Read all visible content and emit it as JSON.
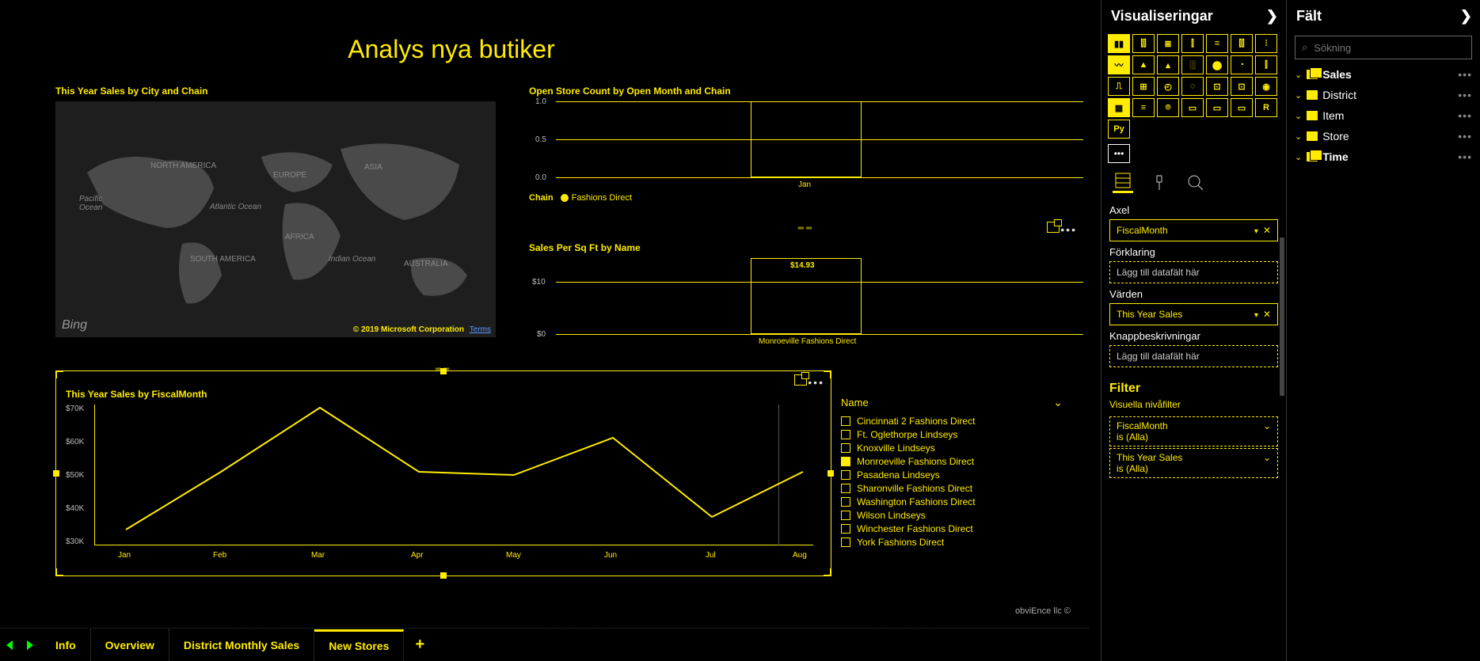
{
  "page_title": "Analys nya butiker",
  "map": {
    "title": "This Year Sales by City and Chain",
    "labels": [
      "NORTH AMERICA",
      "EUROPE",
      "ASIA",
      "AFRICA",
      "SOUTH AMERICA",
      "AUSTRALIA",
      "Pacific Ocean",
      "Atlantic Ocean",
      "Indian Ocean"
    ],
    "provider": "Bing",
    "copyright": "© 2019 Microsoft Corporation",
    "terms": "Terms"
  },
  "bar1": {
    "title": "Open Store Count by Open Month and Chain",
    "legend_label": "Chain",
    "legend_item": "Fashions Direct"
  },
  "bar2": {
    "title": "Sales Per Sq Ft by Name",
    "value_label": "$14.93"
  },
  "line": {
    "title": "This Year Sales by FiscalMonth"
  },
  "slicer": {
    "title": "Name",
    "items": [
      {
        "label": "Cincinnati 2 Fashions Direct",
        "checked": false
      },
      {
        "label": "Ft. Oglethorpe Lindseys",
        "checked": false
      },
      {
        "label": "Knoxville Lindseys",
        "checked": false
      },
      {
        "label": "Monroeville Fashions Direct",
        "checked": true
      },
      {
        "label": "Pasadena Lindseys",
        "checked": false
      },
      {
        "label": "Sharonville Fashions Direct",
        "checked": false
      },
      {
        "label": "Washington Fashions Direct",
        "checked": false
      },
      {
        "label": "Wilson Lindseys",
        "checked": false
      },
      {
        "label": "Winchester Fashions Direct",
        "checked": false
      },
      {
        "label": "York Fashions Direct",
        "checked": false
      }
    ]
  },
  "attribution": "obviEnce llc ©",
  "tabs": [
    "Info",
    "Overview",
    "District Monthly Sales",
    "New Stores"
  ],
  "active_tab": 3,
  "viz_panel": {
    "title": "Visualiseringar",
    "tool_labels": [
      "Fields",
      "Format",
      "Analytics"
    ],
    "wells": {
      "axis": {
        "label": "Axel",
        "field": "FiscalMonth"
      },
      "legend": {
        "label": "Förklaring",
        "placeholder": "Lägg till datafält här"
      },
      "values": {
        "label": "Värden",
        "field": "This Year Sales"
      },
      "tooltips": {
        "label": "Knappbeskrivningar",
        "placeholder": "Lägg till datafält här"
      }
    },
    "filters": {
      "header": "Filter",
      "sub": "Visuella nivåfilter",
      "items": [
        {
          "name": "FiscalMonth",
          "state": "is (Alla)"
        },
        {
          "name": "This Year Sales",
          "state": "is (Alla)"
        }
      ]
    }
  },
  "fields_panel": {
    "title": "Fält",
    "search_placeholder": "Sökning",
    "tables": [
      {
        "name": "Sales",
        "bold": true,
        "double": true
      },
      {
        "name": "District",
        "bold": false,
        "double": false
      },
      {
        "name": "Item",
        "bold": false,
        "double": false
      },
      {
        "name": "Store",
        "bold": false,
        "double": false
      },
      {
        "name": "Time",
        "bold": true,
        "double": true
      }
    ]
  },
  "chart_data": [
    {
      "type": "bar",
      "title": "Open Store Count by Open Month and Chain",
      "categories": [
        "Jan"
      ],
      "series": [
        {
          "name": "Fashions Direct",
          "values": [
            1.0
          ]
        }
      ],
      "ylabel": "",
      "ylim": [
        0,
        1.0
      ],
      "yticks": [
        0.0,
        0.5,
        1.0
      ]
    },
    {
      "type": "bar",
      "title": "Sales Per Sq Ft by Name",
      "categories": [
        "Monroeville Fashions Direct"
      ],
      "values": [
        14.93
      ],
      "ylabel": "$",
      "ylim": [
        0,
        15
      ],
      "yticks": [
        0,
        10
      ],
      "data_labels": [
        "$14.93"
      ]
    },
    {
      "type": "line",
      "title": "This Year Sales by FiscalMonth",
      "x": [
        "Jan",
        "Feb",
        "Mar",
        "Apr",
        "May",
        "Jun",
        "Jul",
        "Aug"
      ],
      "series": [
        {
          "name": "This Year Sales",
          "values": [
            33000,
            50000,
            69000,
            50000,
            49000,
            60000,
            37000,
            50000
          ]
        }
      ],
      "ylabel": "$",
      "ylim": [
        30000,
        70000
      ],
      "yticks": [
        "$30K",
        "$40K",
        "$50K",
        "$60K",
        "$70K"
      ]
    }
  ]
}
